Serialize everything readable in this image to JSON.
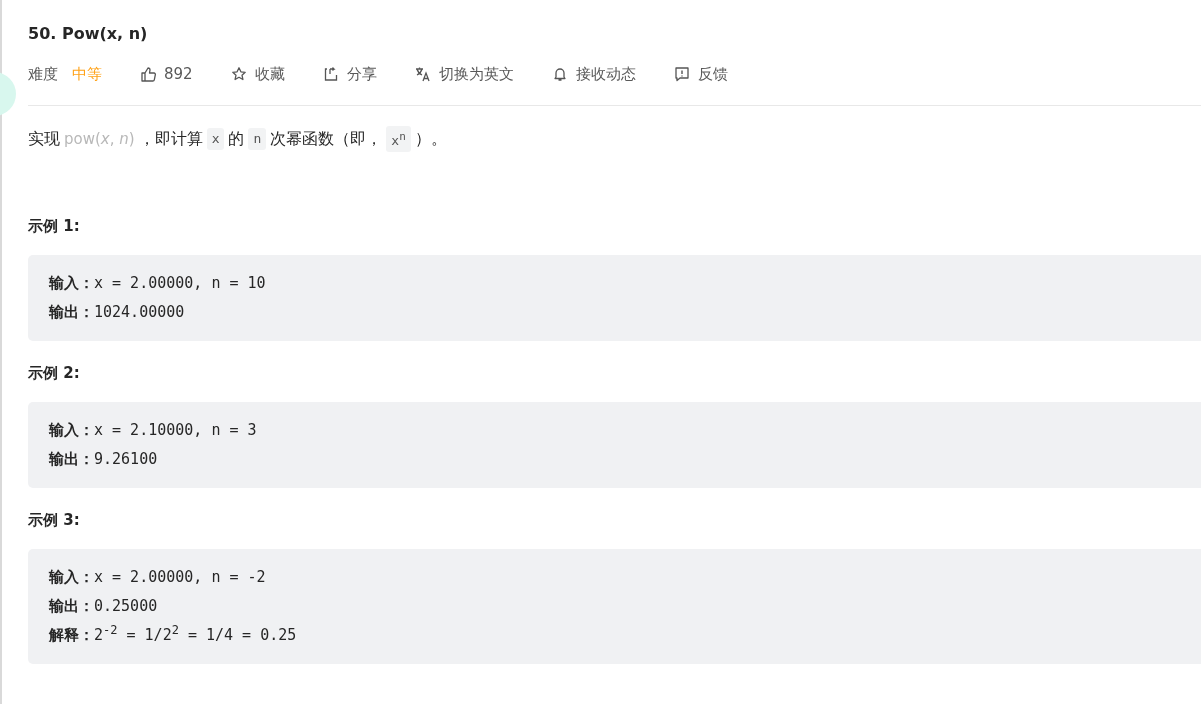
{
  "title": "50. Pow(x, n)",
  "toolbar": [
    {
      "kind": "difficulty",
      "label": "难度",
      "value": "中等"
    },
    {
      "kind": "like",
      "label": "892"
    },
    {
      "kind": "star",
      "label": "收藏"
    },
    {
      "kind": "share",
      "label": "分享"
    },
    {
      "kind": "translate",
      "label": "切换为英文"
    },
    {
      "kind": "bell",
      "label": "接收动态"
    },
    {
      "kind": "feedback",
      "label": "反馈"
    }
  ],
  "description": [
    {
      "kind": "text",
      "text": "实现"
    },
    {
      "kind": "link",
      "text": "pow(*x*, *n*)"
    },
    {
      "kind": "text",
      "text": "，即计算"
    },
    {
      "kind": "code",
      "text": "x"
    },
    {
      "kind": "text",
      "text": "的"
    },
    {
      "kind": "code",
      "text": "n"
    },
    {
      "kind": "text",
      "text": "次幂函数（即，"
    },
    {
      "kind": "code",
      "text": "x$^{n}$"
    },
    {
      "kind": "text",
      "text": "）。"
    }
  ],
  "examples": [
    {
      "heading": "示例 1:",
      "lines": [
        "**输入：**x = 2.00000, n = 10",
        "**输出：**1024.00000"
      ]
    },
    {
      "heading": "示例 2:",
      "lines": [
        "**输入：**x = 2.10000, n = 3",
        "**输出：**9.26100"
      ]
    },
    {
      "heading": "示例 3:",
      "lines": [
        "**输入：**x = 2.00000, n = -2",
        "**输出：**0.25000",
        "**解释：**2$^{-2}$ = 1/2$^{2}$ = 1/4 = 0.25"
      ]
    }
  ]
}
